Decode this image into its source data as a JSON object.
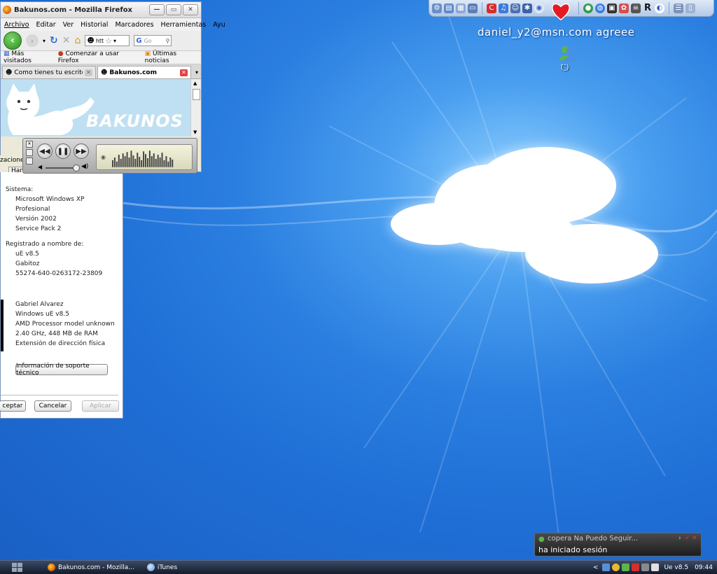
{
  "colors": {
    "desktop": "#1f6fd6",
    "taskbar": "#1a2334",
    "green": "#2f8f1f"
  },
  "desktop": {
    "msn_user": "daniel_y2@msn.com  agreee",
    "msn_icon_label": "(̄_̄)"
  },
  "firefox": {
    "title": "Bakunos.com - Mozilla Firefox",
    "menu": [
      "Archivo",
      "Editar",
      "Ver",
      "Historial",
      "Marcadores",
      "Herramientas",
      "Ayu"
    ],
    "url_text": "htt",
    "search_placeholder": "Go",
    "bookmarks": [
      "Más visitados",
      "Comenzar a usar Firefox",
      "Últimas noticias"
    ],
    "tabs": [
      {
        "label": "Como tienes tu escritori..."
      },
      {
        "label": "Bakunos.com"
      }
    ],
    "site_logo": "BAKUNOS"
  },
  "dialog": {
    "tab_labels": [
      "zaciones",
      "Hardw"
    ],
    "system_label": "Sistema:",
    "system_lines": [
      "Microsoft Windows XP",
      "Profesional",
      "Versión 2002",
      "Service Pack 2"
    ],
    "registered_label": "Registrado a nombre de:",
    "registered_lines": [
      "uE v8.5",
      "Gabitoz",
      "55274-640-0263172-23809"
    ],
    "computer_lines": [
      "Gabriel Alvarez",
      "Windows uE v8.5",
      "AMD Processor model unknown",
      "2.40 GHz, 448 MB de RAM",
      "Extensión de dirección física"
    ],
    "support_button": "Información de soporte técnico",
    "accept_button": "ceptar",
    "cancel_button": "Cancelar",
    "apply_button": "Aplicar"
  },
  "notification": {
    "line1": "copera Na Puedo Seguir...",
    "line2": "ha iniciado sesión"
  },
  "taskbar": {
    "tasks": [
      {
        "label": "Bakunos.com - Mozilla..."
      },
      {
        "label": "iTunes"
      }
    ],
    "tray_chevron": "<",
    "version": "Ue v8.5",
    "clock": "09:44"
  }
}
